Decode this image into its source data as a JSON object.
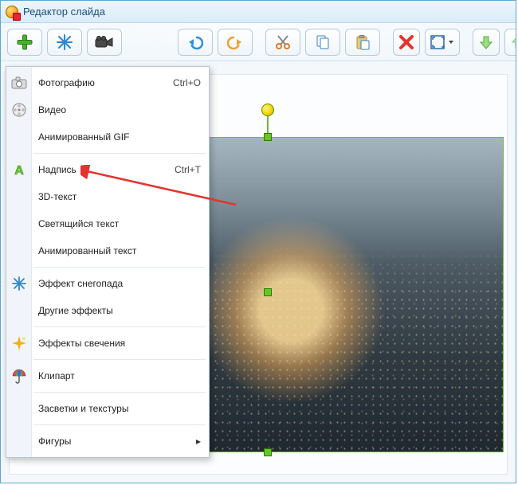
{
  "window": {
    "title": "Редактор слайда"
  },
  "toolbar": {
    "add": "add",
    "effects_btn": "effects",
    "camera": "camera",
    "undo": "undo",
    "redo": "redo",
    "cut": "cut",
    "copy": "copy",
    "paste": "paste",
    "delete": "delete",
    "fit": "fit",
    "layer_down": "down",
    "layer_up": "up"
  },
  "menu": {
    "items": [
      {
        "label": "Фотографию",
        "shortcut": "Ctrl+O",
        "icon": "camera"
      },
      {
        "label": "Видео",
        "shortcut": "",
        "icon": "film"
      },
      {
        "label": "Анимированный GIF",
        "shortcut": "",
        "icon": ""
      },
      {
        "sep": true
      },
      {
        "label": "Надпись",
        "shortcut": "Ctrl+T",
        "icon": "text-a"
      },
      {
        "label": "3D-текст",
        "shortcut": "",
        "icon": ""
      },
      {
        "label": "Светящийся текст",
        "shortcut": "",
        "icon": ""
      },
      {
        "label": "Анимированный текст",
        "shortcut": "",
        "icon": ""
      },
      {
        "sep": true
      },
      {
        "label": "Эффект снегопада",
        "shortcut": "",
        "icon": "snow"
      },
      {
        "label": "Другие эффекты",
        "shortcut": "",
        "icon": ""
      },
      {
        "sep": true
      },
      {
        "label": "Эффекты свечения",
        "shortcut": "",
        "icon": "sparkle"
      },
      {
        "sep": true
      },
      {
        "label": "Клипарт",
        "shortcut": "",
        "icon": "umbrella"
      },
      {
        "sep": true
      },
      {
        "label": "Засветки и текстуры",
        "shortcut": "",
        "icon": ""
      },
      {
        "sep": true
      },
      {
        "label": "Фигуры",
        "shortcut": "",
        "icon": "",
        "submenu": true
      }
    ]
  },
  "annotation": {
    "points_to_item_index": 4
  }
}
